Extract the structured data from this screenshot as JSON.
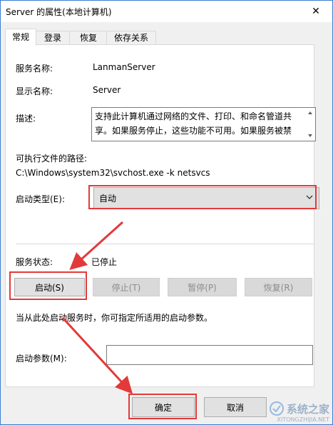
{
  "window": {
    "title": "Server 的属性(本地计算机)",
    "close_glyph": "✕"
  },
  "tabs": [
    {
      "label": "常规",
      "active": true
    },
    {
      "label": "登录",
      "active": false
    },
    {
      "label": "恢复",
      "active": false
    },
    {
      "label": "依存关系",
      "active": false
    }
  ],
  "general": {
    "service_name_label": "服务名称:",
    "service_name_value": "LanmanServer",
    "display_name_label": "显示名称:",
    "display_name_value": "Server",
    "description_label": "描述:",
    "description_value": "支持此计算机通过网络的文件、打印、和命名管道共享。如果服务停止，这些功能不可用。如果服务被禁用，",
    "exe_path_label": "可执行文件的路径:",
    "exe_path_value": "C:\\Windows\\system32\\svchost.exe -k netsvcs",
    "startup_type_label": "启动类型(E):",
    "startup_type_value": "自动",
    "service_status_label": "服务状态:",
    "service_status_value": "已停止",
    "buttons": {
      "start": "启动(S)",
      "stop": "停止(T)",
      "pause": "暂停(P)",
      "resume": "恢复(R)"
    },
    "hint": "当从此处启动服务时，你可指定所适用的启动参数。",
    "start_params_label": "启动参数(M):",
    "start_params_value": ""
  },
  "footer": {
    "ok": "确定",
    "cancel": "取消"
  },
  "watermark": {
    "text": "系统之家",
    "url": "XITONGZHIJIA.NET"
  },
  "colors": {
    "highlight": "#e23a3a",
    "titlebar_border": "#3a7fd0"
  }
}
